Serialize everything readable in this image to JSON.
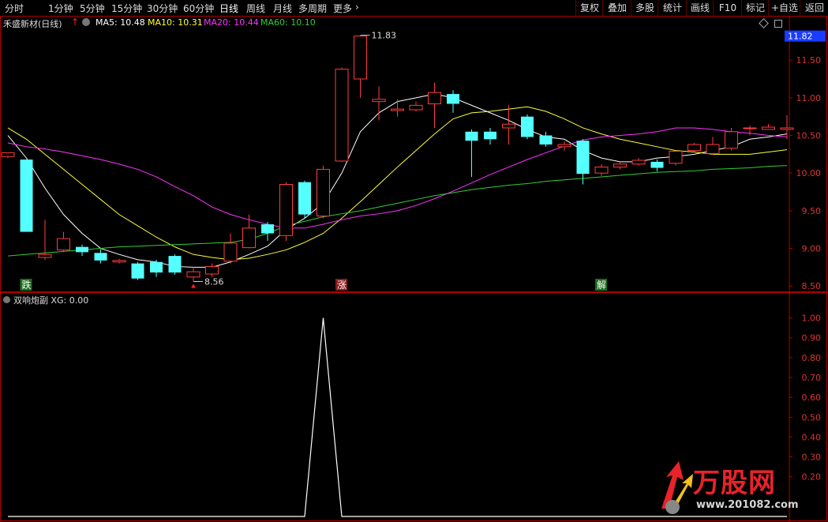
{
  "toolbar": {
    "timeframes": [
      "分时",
      "1分钟",
      "5分钟",
      "15分钟",
      "30分钟",
      "60分钟",
      "日线",
      "周线",
      "月线",
      "多周期",
      "更多"
    ],
    "active": "日线",
    "more_arrow": "›",
    "actions": [
      "复权",
      "叠加",
      "多股",
      "统计",
      "画线",
      "F10",
      "标记",
      "+自选",
      "返回"
    ]
  },
  "header": {
    "stock": "禾盛新材(日线)",
    "ma5_label": "MA5: 10.48",
    "ma10_label": "MA10: 10.31",
    "ma20_label": "MA20: 10.44",
    "ma60_label": "MA60: 10.10"
  },
  "price_axis": {
    "current_price_tag": "11.82",
    "ticks": [
      "11.50",
      "11.00",
      "10.50",
      "10.00",
      "9.50",
      "9.00",
      "8.50"
    ]
  },
  "annotations": {
    "high_label": "11.83",
    "low_label": "8.56",
    "signal_die": "跌",
    "signal_zhang": "涨",
    "signal_jie": "解"
  },
  "indicator": {
    "title": "双响炮副  XG: 0.00",
    "ticks": [
      "1.00",
      "0.90",
      "0.80",
      "0.70",
      "0.60",
      "0.50",
      "0.40",
      "0.30",
      "0.20"
    ]
  },
  "logo": {
    "text": "万股网",
    "url": "www.201082.com"
  },
  "colors": {
    "up": "#ff3c3c",
    "down": "#54ffff",
    "ma5": "#ffffff",
    "ma10": "#ffff33",
    "ma20": "#ff33ff",
    "ma60": "#33cc33",
    "border": "#b00000"
  },
  "chart_data": {
    "type": "candlestick",
    "ylim": [
      8.45,
      11.9
    ],
    "high": 11.83,
    "low": 8.56,
    "candles": [
      [
        10.22,
        10.27,
        10.2,
        10.27
      ],
      [
        10.18,
        9.22,
        9.22,
        10.18
      ],
      [
        8.88,
        8.92,
        8.85,
        9.38
      ],
      [
        8.98,
        9.13,
        8.95,
        9.22
      ],
      [
        9.02,
        8.95,
        8.9,
        9.05
      ],
      [
        8.94,
        8.84,
        8.8,
        8.99
      ],
      [
        8.82,
        8.84,
        8.8,
        8.86
      ],
      [
        8.8,
        8.6,
        8.58,
        8.82
      ],
      [
        8.82,
        8.68,
        8.62,
        8.85
      ],
      [
        8.9,
        8.68,
        8.65,
        8.92
      ],
      [
        8.62,
        8.69,
        8.56,
        8.75
      ],
      [
        8.66,
        8.76,
        8.62,
        8.8
      ],
      [
        8.83,
        9.07,
        8.8,
        9.2
      ],
      [
        9.01,
        9.27,
        9.0,
        9.45
      ],
      [
        9.32,
        9.2,
        9.1,
        9.35
      ],
      [
        9.17,
        9.85,
        9.1,
        9.88
      ],
      [
        9.88,
        9.45,
        9.4,
        9.9
      ],
      [
        9.43,
        10.05,
        9.4,
        10.1
      ],
      [
        10.16,
        11.38,
        10.15,
        11.4
      ],
      [
        11.25,
        11.82,
        11.0,
        11.83
      ],
      [
        10.95,
        10.98,
        10.7,
        11.15
      ],
      [
        10.83,
        10.85,
        10.75,
        10.98
      ],
      [
        10.84,
        10.9,
        10.82,
        10.95
      ],
      [
        10.92,
        11.07,
        10.6,
        11.2
      ],
      [
        11.05,
        10.92,
        10.8,
        11.1
      ],
      [
        10.55,
        10.43,
        9.95,
        10.58
      ],
      [
        10.55,
        10.45,
        10.38,
        10.6
      ],
      [
        10.6,
        10.65,
        10.38,
        10.9
      ],
      [
        10.75,
        10.48,
        10.45,
        10.78
      ],
      [
        10.5,
        10.38,
        10.35,
        10.55
      ],
      [
        10.35,
        10.38,
        10.3,
        10.42
      ],
      [
        10.43,
        9.99,
        9.85,
        10.45
      ],
      [
        10.0,
        10.08,
        9.96,
        10.12
      ],
      [
        10.08,
        10.12,
        10.05,
        10.15
      ],
      [
        10.12,
        10.17,
        10.1,
        10.2
      ],
      [
        10.15,
        10.07,
        10.02,
        10.18
      ],
      [
        10.13,
        10.29,
        10.1,
        10.3
      ],
      [
        10.3,
        10.38,
        10.28,
        10.4
      ],
      [
        10.26,
        10.38,
        10.24,
        10.48
      ],
      [
        10.33,
        10.55,
        10.3,
        10.6
      ],
      [
        10.6,
        10.6,
        10.5,
        10.63
      ],
      [
        10.58,
        10.61,
        10.58,
        10.65
      ],
      [
        10.58,
        10.6,
        10.45,
        10.77
      ]
    ],
    "series": [
      {
        "name": "MA5",
        "values": [
          10.5,
          10.2,
          9.8,
          9.45,
          9.2,
          9.0,
          8.92,
          8.85,
          8.82,
          8.76,
          8.75,
          8.75,
          8.82,
          8.92,
          9.03,
          9.25,
          9.4,
          9.6,
          10.0,
          10.55,
          10.8,
          10.95,
          11.0,
          11.05,
          11.0,
          10.9,
          10.8,
          10.7,
          10.58,
          10.48,
          10.45,
          10.3,
          10.2,
          10.15,
          10.15,
          10.2,
          10.22,
          10.25,
          10.3,
          10.35,
          10.45,
          10.48,
          10.52
        ]
      },
      {
        "name": "MA10",
        "values": [
          10.6,
          10.45,
          10.25,
          10.05,
          9.85,
          9.65,
          9.45,
          9.3,
          9.15,
          9.02,
          8.92,
          8.88,
          8.85,
          8.87,
          8.92,
          8.98,
          9.08,
          9.2,
          9.4,
          9.62,
          9.85,
          10.08,
          10.3,
          10.52,
          10.72,
          10.8,
          10.82,
          10.85,
          10.88,
          10.82,
          10.72,
          10.6,
          10.52,
          10.45,
          10.4,
          10.35,
          10.3,
          10.28,
          10.25,
          10.25,
          10.25,
          10.28,
          10.31
        ]
      },
      {
        "name": "MA20",
        "values": [
          10.4,
          10.35,
          10.32,
          10.28,
          10.23,
          10.18,
          10.12,
          10.05,
          9.95,
          9.82,
          9.7,
          9.55,
          9.45,
          9.38,
          9.32,
          9.27,
          9.27,
          9.32,
          9.38,
          9.43,
          9.46,
          9.5,
          9.57,
          9.66,
          9.76,
          9.87,
          9.98,
          10.08,
          10.18,
          10.27,
          10.36,
          10.44,
          10.48,
          10.5,
          10.52,
          10.55,
          10.6,
          10.6,
          10.58,
          10.55,
          10.53,
          10.5,
          10.48
        ]
      },
      {
        "name": "MA60",
        "values": [
          8.9,
          8.92,
          8.94,
          8.96,
          8.98,
          9.0,
          9.02,
          9.03,
          9.04,
          9.05,
          9.06,
          9.07,
          9.08,
          9.12,
          9.2,
          9.3,
          9.36,
          9.42,
          9.46,
          9.5,
          9.55,
          9.6,
          9.65,
          9.7,
          9.74,
          9.78,
          9.81,
          9.84,
          9.86,
          9.89,
          9.91,
          9.93,
          9.95,
          9.97,
          9.99,
          10.01,
          10.02,
          10.03,
          10.05,
          10.06,
          10.07,
          10.09,
          10.1
        ]
      }
    ],
    "indicator_series": {
      "name": "XG",
      "ylim": [
        0,
        1.05
      ],
      "values": [
        0,
        0,
        0,
        0,
        0,
        0,
        0,
        0,
        0,
        0,
        0,
        0,
        0,
        0,
        0,
        0,
        0,
        1,
        0,
        0,
        0,
        0,
        0,
        0,
        0,
        0,
        0,
        0,
        0,
        0,
        0,
        0,
        0,
        0,
        0,
        0,
        0,
        0,
        0,
        0,
        0,
        0,
        0
      ]
    }
  }
}
